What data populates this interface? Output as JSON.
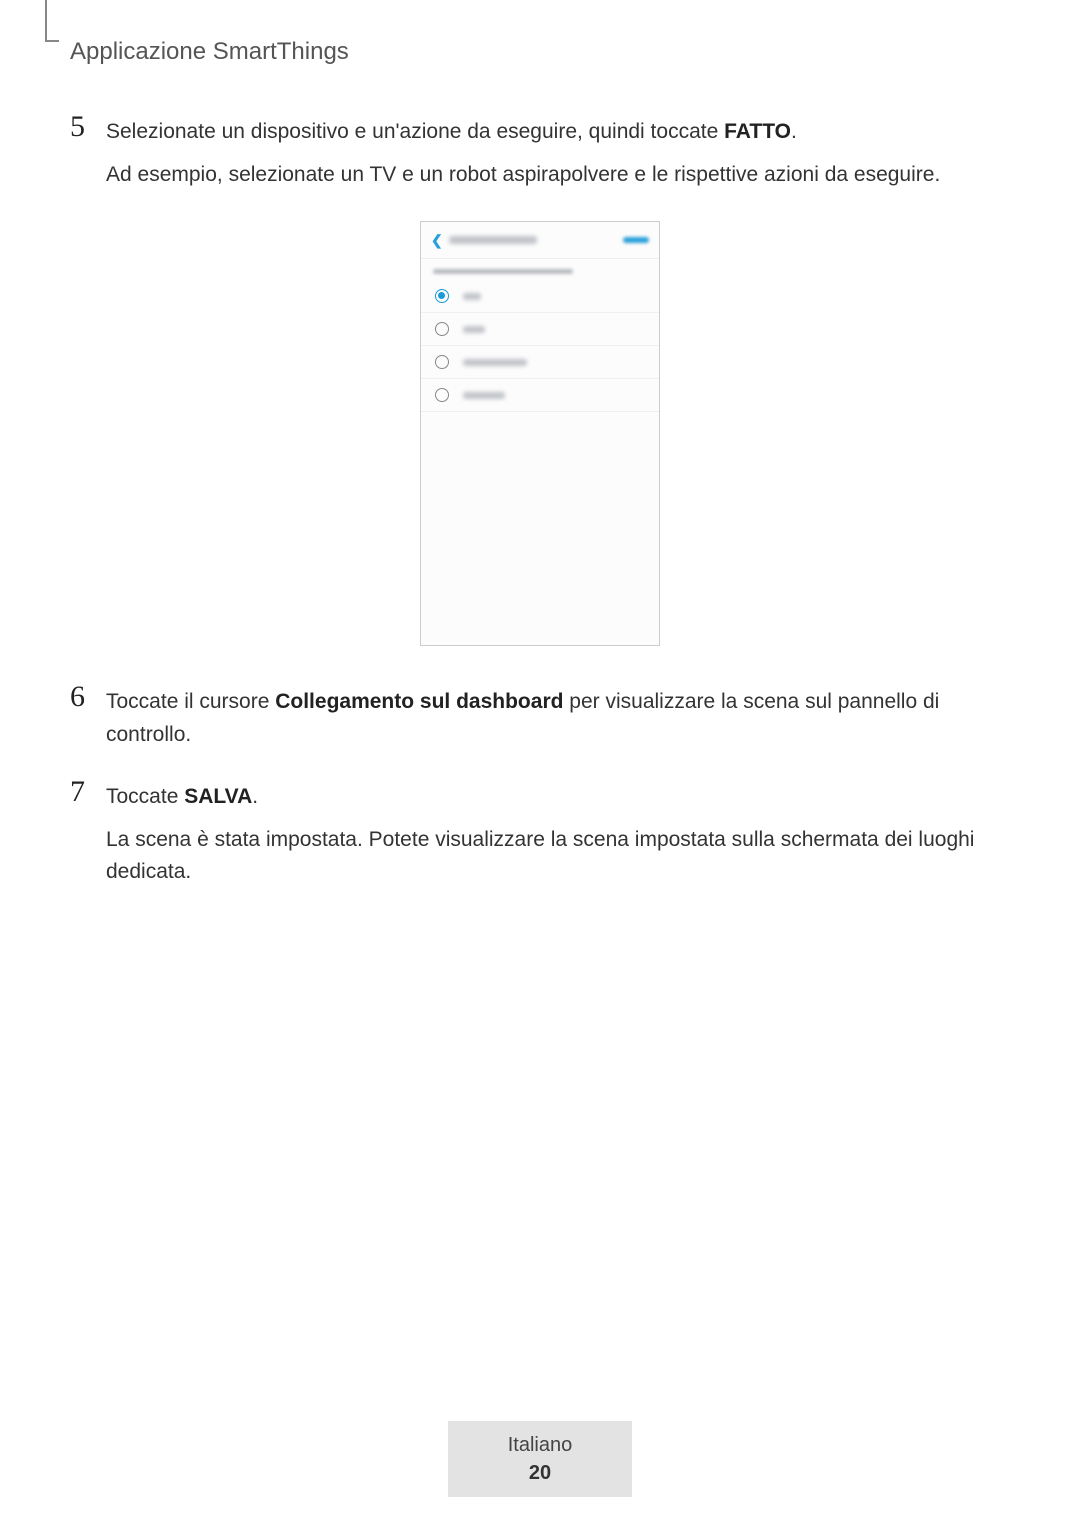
{
  "header": {
    "section_title": "Applicazione SmartThings"
  },
  "steps": {
    "s5": {
      "num": "5",
      "line1_pre": "Selezionate un dispositivo e un'azione da eseguire, quindi toccate ",
      "line1_strong": "FATTO",
      "line1_post": ".",
      "line2": "Ad esempio, selezionate un TV e un robot aspirapolvere e le rispettive azioni da eseguire."
    },
    "s6": {
      "num": "6",
      "line1_pre": "Toccate il cursore ",
      "line1_strong": "Collegamento sul dashboard",
      "line1_post": " per visualizzare la scena sul pannello di controllo."
    },
    "s7": {
      "num": "7",
      "line1_pre": "Toccate ",
      "line1_strong": "SALVA",
      "line1_post": ".",
      "line2": "La scena è stata impostata. Potete visualizzare la scena impostata sulla schermata dei luoghi dedicata."
    }
  },
  "mock": {
    "rows": [
      {
        "selected": true,
        "label_width": 18
      },
      {
        "selected": false,
        "label_width": 22
      },
      {
        "selected": false,
        "label_width": 64
      },
      {
        "selected": false,
        "label_width": 42
      }
    ]
  },
  "footer": {
    "language": "Italiano",
    "page": "20"
  }
}
